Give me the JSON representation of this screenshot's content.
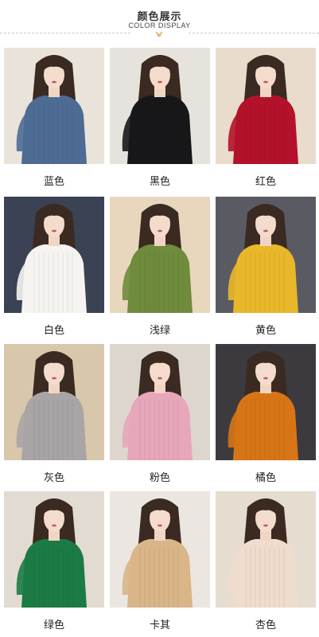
{
  "header": {
    "title": "颜色展示",
    "subtitle": "COLOR DISPLAY",
    "divider_icon": "chevron-down-icon"
  },
  "colors": [
    {
      "label": "蓝色",
      "sweater": "#4d6b93",
      "bg": "#eae3da"
    },
    {
      "label": "黑色",
      "sweater": "#17171a",
      "bg": "#e6e2dc"
    },
    {
      "label": "红色",
      "sweater": "#b3122a",
      "bg": "#e9dccc"
    },
    {
      "label": "白色",
      "sweater": "#f6f4f1",
      "bg": "#3a4254"
    },
    {
      "label": "浅绿",
      "sweater": "#6f8b3c",
      "bg": "#e8d7bd"
    },
    {
      "label": "黄色",
      "sweater": "#e9b72a",
      "bg": "#5a5a63"
    },
    {
      "label": "灰色",
      "sweater": "#a9a5a6",
      "bg": "#d9c7ac"
    },
    {
      "label": "粉色",
      "sweater": "#e7a6ba",
      "bg": "#ddd6cf"
    },
    {
      "label": "橘色",
      "sweater": "#d77516",
      "bg": "#3d3a3f"
    },
    {
      "label": "绿色",
      "sweater": "#1c7b45",
      "bg": "#e2dbd2"
    },
    {
      "label": "卡其",
      "sweater": "#d9b588",
      "bg": "#ebe6df"
    },
    {
      "label": "杏色",
      "sweater": "#efdccd",
      "bg": "#e6dccf"
    }
  ]
}
